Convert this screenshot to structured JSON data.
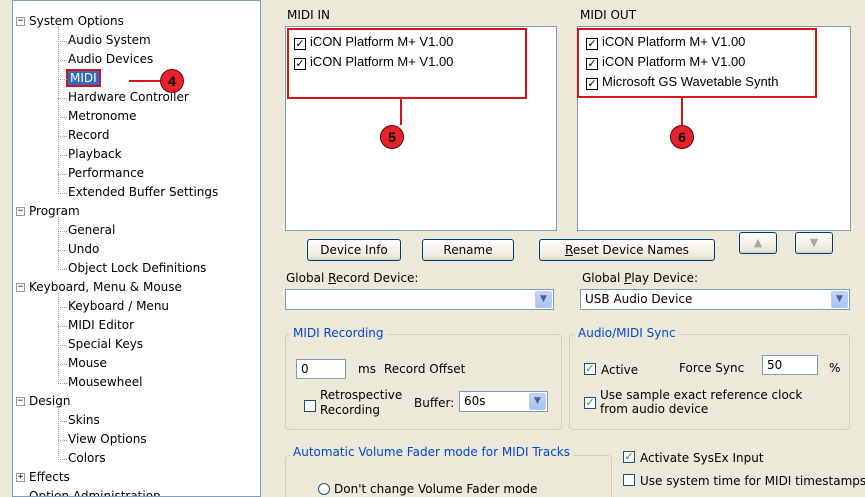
{
  "tree": {
    "categories": [
      {
        "label": "System Options",
        "sign": "−",
        "children": [
          "Audio System",
          "Audio Devices",
          "MIDI",
          "Hardware Controller",
          "Metronome",
          "Record",
          "Playback",
          "Performance",
          "Extended Buffer Settings"
        ]
      },
      {
        "label": "Program",
        "sign": "−",
        "children": [
          "General",
          "Undo",
          "Object Lock Definitions"
        ]
      },
      {
        "label": "Keyboard, Menu & Mouse",
        "sign": "−",
        "children": [
          "Keyboard / Menu",
          "MIDI Editor",
          "Special Keys",
          "Mouse",
          "Mousewheel"
        ]
      },
      {
        "label": "Design",
        "sign": "−",
        "children": [
          "Skins",
          "View Options",
          "Colors"
        ]
      },
      {
        "label": "Effects",
        "sign": "+",
        "children": []
      }
    ],
    "selected": "MIDI",
    "cut_off_label": "Option Administration"
  },
  "callouts": {
    "c4": "4",
    "c5": "5",
    "c6": "6"
  },
  "midi_in": {
    "title": "MIDI IN",
    "items": [
      {
        "label": "iCON Platform M+ V1.00",
        "checked": true
      },
      {
        "label": "iCON Platform M+ V1.00",
        "checked": true
      }
    ]
  },
  "midi_out": {
    "title": "MIDI OUT",
    "items": [
      {
        "label": "iCON Platform M+ V1.00",
        "checked": true
      },
      {
        "label": "iCON Platform M+ V1.00",
        "checked": true
      },
      {
        "label": "Microsoft GS Wavetable Synth",
        "checked": true
      }
    ]
  },
  "buttons": {
    "device_info": "Device Info",
    "rename": "Rename",
    "reset_prefix": "R",
    "reset_rest": "eset Device Names",
    "up": "▲",
    "down": "▼"
  },
  "global_record": {
    "label_a": "Global ",
    "label_u": "R",
    "label_b": "ecord Device:",
    "value": ""
  },
  "global_play": {
    "label_a": "Global ",
    "label_u": "P",
    "label_b": "lay Device:",
    "value": "USB Audio Device"
  },
  "midi_recording": {
    "title": "MIDI Recording",
    "offset_value": "0",
    "offset_unit": "ms",
    "offset_label": "Record Offset",
    "retro_line1": "Retrospective",
    "retro_line2": "Recording",
    "retro_checked": false,
    "buffer_label": "Buffer:",
    "buffer_value": "60s"
  },
  "sync": {
    "title": "Audio/MIDI Sync",
    "active_label": "Active",
    "active_checked": true,
    "force_sync_label": "Force Sync",
    "force_sync_value": "50",
    "force_sync_unit": "%",
    "sample_line1": "Use sample exact reference clock",
    "sample_line2": "from audio device",
    "sample_checked": true
  },
  "fader": {
    "title": "Automatic Volume Fader mode for MIDI Tracks",
    "option1": "Don't change Volume Fader mode"
  },
  "sysex": {
    "label": "Activate SysEx Input",
    "checked": true
  },
  "timestamps": {
    "label": "Use system time for MIDI timestamps",
    "checked": false
  },
  "colors": {
    "accent": "#d4141c",
    "selection": "#316ac5",
    "group_title": "#0046d5"
  }
}
